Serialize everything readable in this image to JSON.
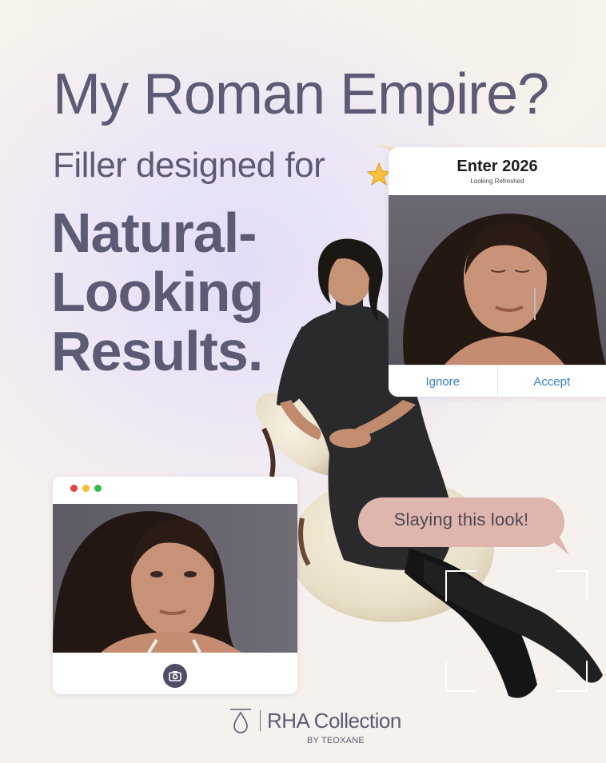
{
  "headline": "My Roman Empire?",
  "subhead": "Filler designed for",
  "emphasis": {
    "line1": "Natural-",
    "line2": "Looking",
    "line3": "Results."
  },
  "notification": {
    "title": "Enter 2026",
    "subtitle": "Looking Refreshed",
    "ignore_label": "Ignore",
    "accept_label": "Accept"
  },
  "window": {
    "dots": [
      "#e4453a",
      "#f1bd2c",
      "#2fbb4f"
    ],
    "camera_icon": "camera-icon"
  },
  "bubble": {
    "text": "Slaying this look!",
    "color": "#dfb6ae"
  },
  "brand": {
    "name": "RHA Collection",
    "byline": "BY TEOXANE",
    "text_color": "#5d5a75"
  }
}
